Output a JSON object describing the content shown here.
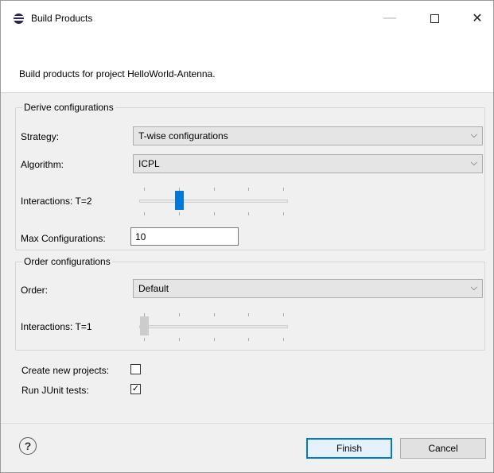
{
  "window": {
    "title": "Build Products",
    "minimize_glyph": "—",
    "close_glyph": "✕"
  },
  "header": {
    "description": "Build products for project HelloWorld-Antenna."
  },
  "derive": {
    "legend": "Derive configurations",
    "strategy_label": "Strategy:",
    "strategy_value": "T-wise configurations",
    "algorithm_label": "Algorithm:",
    "algorithm_value": "ICPL",
    "interactions_label": "Interactions: T=2",
    "interactions_slider": {
      "min": 1,
      "max": 5,
      "value": 2,
      "enabled": true
    },
    "max_configs_label": "Max Configurations:",
    "max_configs_value": "10"
  },
  "order": {
    "legend": "Order configurations",
    "order_label": "Order:",
    "order_value": "Default",
    "interactions_label": "Interactions: T=1",
    "interactions_slider": {
      "min": 1,
      "max": 5,
      "value": 1,
      "enabled": false
    }
  },
  "options": {
    "create_projects_label": "Create new projects:",
    "create_projects_checked": false,
    "run_junit_label": "Run JUnit tests:",
    "run_junit_checked": true,
    "check_glyph": "✓"
  },
  "footer": {
    "help_glyph": "?",
    "finish_label": "Finish",
    "cancel_label": "Cancel"
  },
  "icons": {
    "app": "eclipse-icon",
    "chevron": "chevron-down-icon",
    "chevron_glyph": "⌵",
    "help": "help-icon"
  },
  "colors": {
    "accent": "#0078d7",
    "disabled_thumb": "#cccccc"
  }
}
